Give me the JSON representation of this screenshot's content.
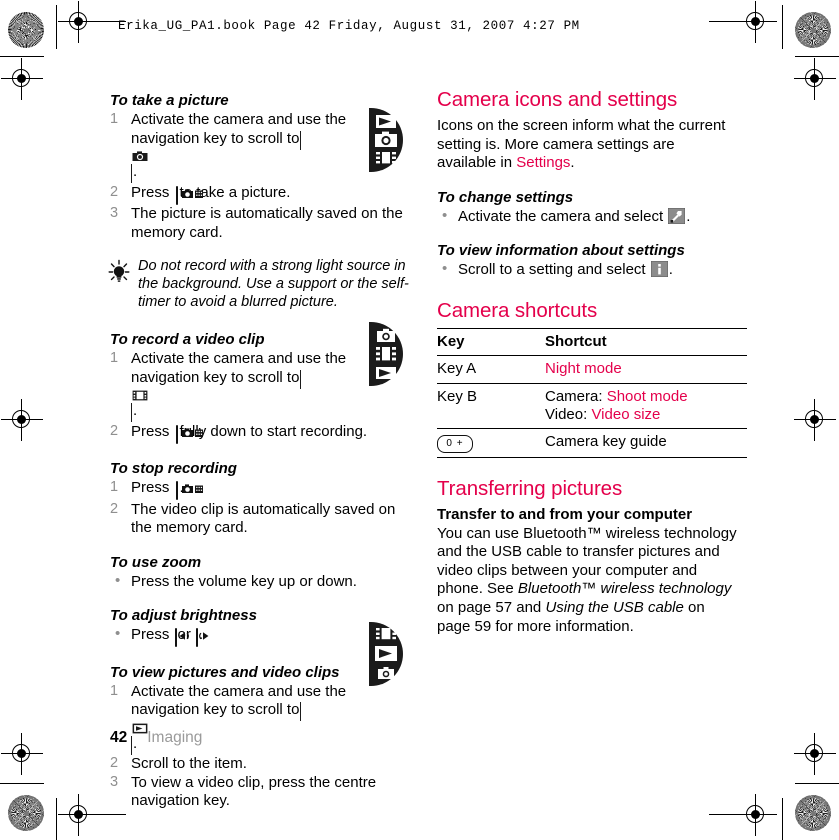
{
  "header": {
    "slug": "Erika_UG_PA1.book  Page 42  Friday, August 31, 2007  4:27 PM"
  },
  "colors": {
    "accent_pink": "#e4004b",
    "step_number_grey": "#8f8f8f",
    "footer_grey": "#9a9a9a",
    "icon_dark": "#1b1b1b"
  },
  "left_column": {
    "blocks": [
      {
        "type": "procedure",
        "heading": "To take a picture",
        "steps": [
          {
            "num": "1",
            "text_before": "Activate the camera and use the navigation key to scroll to ",
            "icon": "camera-screen-icon",
            "text_after": "."
          },
          {
            "num": "2",
            "text_before": "Press ",
            "icon": "camera-key-icon",
            "text_after": " to take a picture."
          },
          {
            "num": "3",
            "text_before": "The picture is automatically saved on the memory card.",
            "icon": null,
            "text_after": ""
          }
        ],
        "thumbnail": "camera-mode-thumbnail"
      },
      {
        "type": "tip",
        "icon": "lightbulb-icon",
        "text": "Do not record with a strong light source in the background. Use a support or the self-timer to avoid a blurred picture."
      },
      {
        "type": "procedure",
        "heading": "To record a video clip",
        "steps": [
          {
            "num": "1",
            "text_before": "Activate the camera and use the navigation key to scroll to ",
            "icon": "video-screen-icon",
            "text_after": "."
          },
          {
            "num": "2",
            "text_before": "Press ",
            "icon": "camera-key-icon",
            "text_after": " fully down to start recording."
          }
        ],
        "thumbnail": "video-mode-thumbnail"
      },
      {
        "type": "procedure",
        "heading": "To stop recording",
        "steps": [
          {
            "num": "1",
            "text_before": "Press ",
            "icon": "camera-key-icon",
            "text_after": "."
          },
          {
            "num": "2",
            "text_before": "The video clip is automatically saved on the memory card.",
            "icon": null,
            "text_after": ""
          }
        ],
        "thumbnail": null
      },
      {
        "type": "bulleted",
        "heading": "To use zoom",
        "bullets": [
          {
            "text_before": "Press the volume key up or down.",
            "icon": null,
            "text_after": ""
          }
        ]
      },
      {
        "type": "bulleted",
        "heading": "To adjust brightness",
        "bullets": [
          {
            "text_before": "Press ",
            "icon": "nav-left-key-icon",
            "text_mid": " or ",
            "icon2": "nav-right-key-icon",
            "text_after": "."
          }
        ]
      },
      {
        "type": "procedure",
        "heading": "To view pictures and video clips",
        "steps": [
          {
            "num": "1",
            "text_before": "Activate the camera and use the navigation key to scroll to ",
            "icon": "playback-screen-icon",
            "text_after": "."
          },
          {
            "num": "2",
            "text_before": "Scroll to the item.",
            "icon": null,
            "text_after": ""
          },
          {
            "num": "3",
            "text_before": "To view a video clip, press the centre navigation key.",
            "icon": null,
            "text_after": ""
          }
        ],
        "thumbnail": "playback-mode-thumbnail"
      }
    ]
  },
  "right_column": {
    "section1": {
      "title": "Camera icons and settings",
      "intro_before": "Icons on the screen inform what the current setting is. More camera settings are available in ",
      "intro_link": "Settings",
      "intro_after": ".",
      "sub1": {
        "heading": "To change settings",
        "bullet_before": "Activate the camera and select ",
        "bullet_icon": "settings-wrench-icon",
        "bullet_after": "."
      },
      "sub2": {
        "heading": "To view information about settings",
        "bullet_before": "Scroll to a setting and select ",
        "bullet_icon": "info-icon",
        "bullet_after": "."
      }
    },
    "section2": {
      "title": "Camera shortcuts",
      "table": {
        "headers": [
          "Key",
          "Shortcut"
        ],
        "rows": [
          {
            "key": "Key A",
            "key_icon": null,
            "shortcut_parts": [
              {
                "text": "Night mode",
                "pink": true
              }
            ]
          },
          {
            "key": "Key B",
            "key_icon": null,
            "shortcut_parts": [
              {
                "text": "Camera: ",
                "pink": false
              },
              {
                "text": "Shoot mode",
                "pink": true
              },
              {
                "text": "\n",
                "pink": false
              },
              {
                "text": "Video: ",
                "pink": false
              },
              {
                "text": "Video size",
                "pink": true
              }
            ]
          },
          {
            "key": "",
            "key_icon": "zero-key-icon",
            "key_icon_label": "0 +",
            "shortcut_parts": [
              {
                "text": "Camera key guide",
                "pink": false
              }
            ]
          }
        ]
      }
    },
    "section3": {
      "title": "Transferring pictures",
      "sub_heading": "Transfer to and from your computer",
      "body_p1": "You can use Bluetooth™ wireless technology and the USB cable to transfer pictures and video clips between your computer and phone. See ",
      "body_em1": "Bluetooth™ wireless technology",
      "body_p2": " on page 57 and ",
      "body_em2": "Using the USB cable",
      "body_p3": " on page 59 for more information."
    }
  },
  "footer": {
    "page_number": "42",
    "section_name": "Imaging"
  }
}
